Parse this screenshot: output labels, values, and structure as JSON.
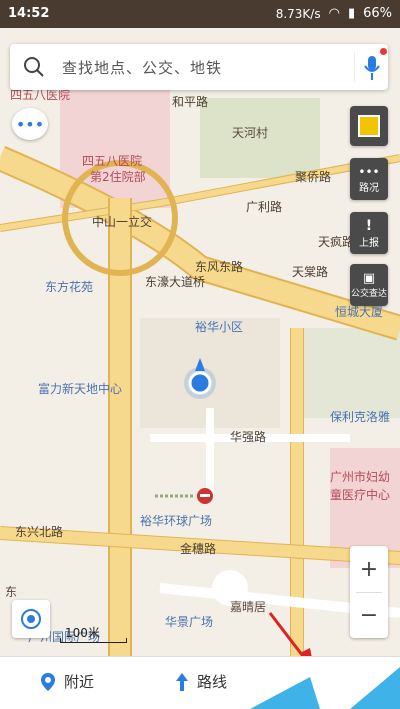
{
  "status": {
    "time": "14:52",
    "network_speed": "8.73K/s",
    "battery": "66%"
  },
  "search": {
    "placeholder": "查找地点、公交、地铁"
  },
  "side_buttons": {
    "traffic_label": "路况",
    "report_label": "上报",
    "bus_label": "公交查达"
  },
  "map_labels": {
    "hospital_1": "四五八医院",
    "hospital_2": "四五八医院",
    "hospital_3": "第2住院部",
    "tianhe_village": "天河村",
    "jugiao_road": "聚侨路",
    "guangli_road": "广利路",
    "tianfeng_road": "天疯路",
    "tiankang": "天棠路",
    "dongfang_garden": "东方花苑",
    "zhongshan": "中山一立交",
    "dongfeng_east": "东风东路",
    "dongbao": "东濠大道桥",
    "yuhan": "裕华小区",
    "hengwei": "恒城大厦",
    "fuli": "富力新天地中心",
    "baoli": "保利克洛雅",
    "huaqiang": "华强路",
    "gz_hospital": "广州市妇幼",
    "gz_hospital_2": "童医疗中心",
    "dongxing": "东兴北路",
    "yuhua": "裕华环球广场",
    "jintai": "金穗路",
    "huaxiang": "华景广场",
    "dongzhou": "东",
    "jiaqing": "嘉晴居",
    "guangzhou_plaza": "广州国际广场",
    "heping": "和平路"
  },
  "scale": "100米",
  "zoom": {
    "in": "+",
    "out": "−"
  },
  "bottom": {
    "nearby": "附近",
    "route": "路线"
  },
  "colors": {
    "road_major": "#f6d98c",
    "road_major_edge": "#e0b453",
    "hospital_area": "#f3d4d4",
    "green_area": "#dde3c8",
    "accent_blue": "#2a7ce0"
  },
  "icons": [
    "search-icon",
    "microphone-icon",
    "message-icon",
    "layers-icon",
    "traffic-icon",
    "report-icon",
    "bus-icon",
    "locate-icon",
    "location-pin-icon",
    "route-arrow-icon"
  ]
}
